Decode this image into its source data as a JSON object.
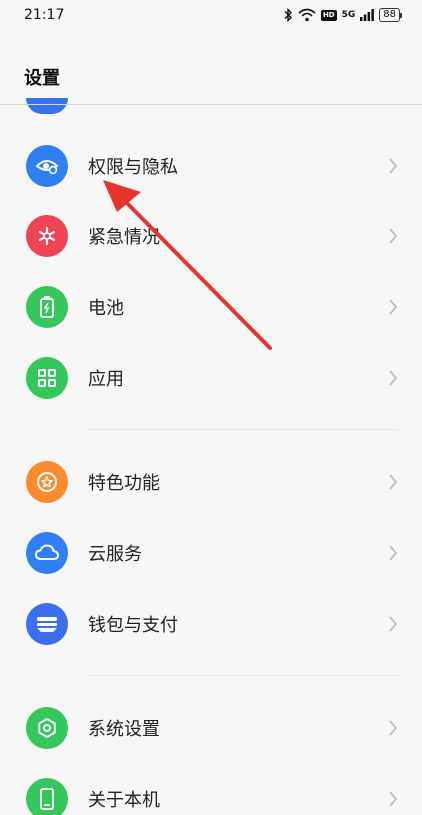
{
  "status_bar": {
    "time": "21:17",
    "hd": "HD",
    "network": "5G",
    "battery": "88",
    "icons": [
      "bluetooth-icon",
      "wifi-icon",
      "hd-icon",
      "signal-icon",
      "battery-icon"
    ]
  },
  "header": {
    "title": "设置"
  },
  "settings": {
    "items": [
      {
        "label": "权限与隐私",
        "icon": "eye-icon",
        "color": "#2f7ff5"
      },
      {
        "label": "紧急情况",
        "icon": "asterisk-icon",
        "color": "#ee4455"
      },
      {
        "label": "电池",
        "icon": "battery-icon",
        "color": "#34c759"
      },
      {
        "label": "应用",
        "icon": "grid-icon",
        "color": "#34c759"
      },
      {
        "label": "特色功能",
        "icon": "star-icon",
        "color": "#ff8a2b"
      },
      {
        "label": "云服务",
        "icon": "cloud-icon",
        "color": "#2f7ff5"
      },
      {
        "label": "钱包与支付",
        "icon": "wallet-icon",
        "color": "#3a6ff0"
      },
      {
        "label": "系统设置",
        "icon": "gear-icon",
        "color": "#34c759"
      },
      {
        "label": "关于本机",
        "icon": "phone-icon",
        "color": "#34c759"
      }
    ]
  },
  "colors": {
    "arrow": "#e8342f",
    "background": "#f7f7f7"
  }
}
